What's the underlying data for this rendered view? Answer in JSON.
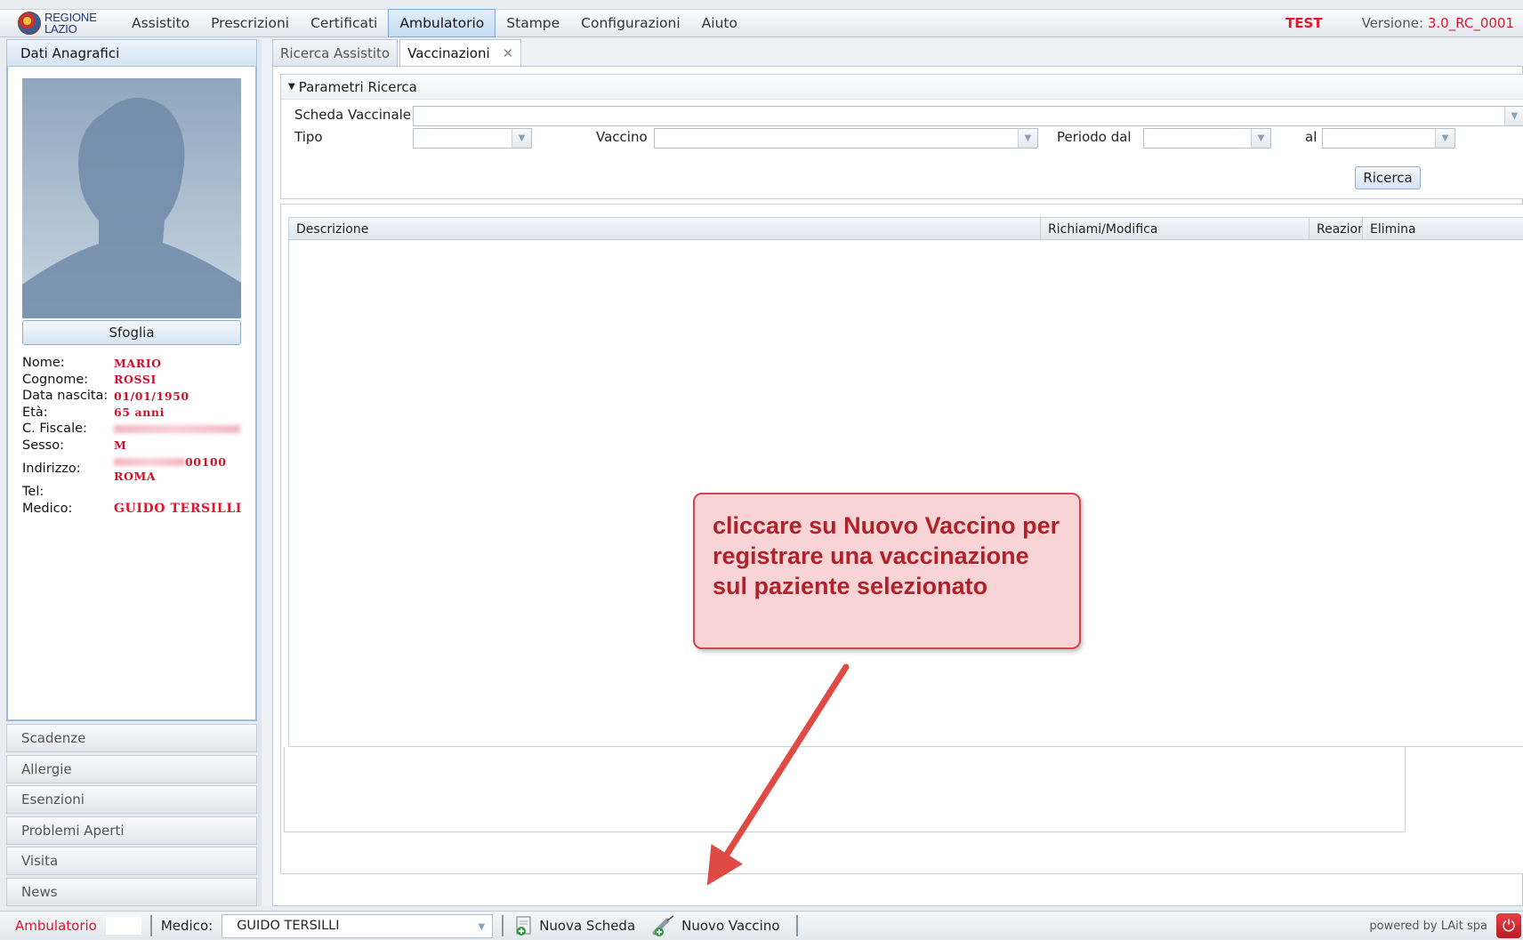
{
  "menubar": {
    "logo_line1": "REGIONE",
    "logo_line2": "LAZIO",
    "items": [
      "Assistito",
      "Prescrizioni",
      "Certificati",
      "Ambulatorio",
      "Stampe",
      "Configurazioni",
      "Aiuto"
    ],
    "active_item": "Ambulatorio",
    "env_label": "TEST",
    "version_label": "Versione:",
    "version_value": "3.0_RC_0001"
  },
  "left_panel": {
    "header": "Dati Anagrafici",
    "browse_button": "Sfoglia",
    "patient": {
      "name_label": "Nome:",
      "name": "MARIO",
      "surname_label": "Cognome:",
      "surname": "ROSSI",
      "birth_label": "Data nascita:",
      "birth": "01/01/1950",
      "age_label": "Età:",
      "age": "65 anni",
      "fiscal_label": "C. Fiscale:",
      "sex_label": "Sesso:",
      "sex": "M",
      "address_label": "Indirizzo:",
      "address_zip": "00100",
      "address_city": "ROMA",
      "tel_label": "Tel:",
      "doctor_label": "Medico:",
      "doctor": "GUIDO TERSILLI"
    },
    "accordion": [
      "Scadenze",
      "Allergie",
      "Esenzioni",
      "Problemi Aperti",
      "Visita",
      "News"
    ]
  },
  "tabs": [
    {
      "label": "Ricerca Assistito",
      "active": false
    },
    {
      "label": "Vaccinazioni",
      "active": true,
      "closable": true
    }
  ],
  "search_params": {
    "title": "Parametri Ricerca",
    "scheda_label": "Scheda Vaccinale",
    "scheda_value": "",
    "tipo_label": "Tipo",
    "tipo_value": "",
    "vaccino_label": "Vaccino",
    "vaccino_value": "",
    "periodo_label": "Periodo dal",
    "periodo_value": "",
    "al_label": "al",
    "al_value": "",
    "search_button": "Ricerca"
  },
  "grid": {
    "columns": [
      "Descrizione",
      "Richiami/Modifica",
      "Reazion",
      "Elimina"
    ],
    "rows": []
  },
  "callout": {
    "text": "cliccare su Nuovo Vaccino per registrare una vaccinazione sul paziente selezionato"
  },
  "statusbar": {
    "context": "Ambulatorio",
    "doctor_label": "Medico:",
    "doctor_value": "GUIDO TERSILLI",
    "new_card_button": "Nuova Scheda",
    "new_vaccine_button": "Nuovo Vaccino",
    "powered_by": "powered by LAit spa"
  },
  "colors": {
    "accent_red": "#e0162b",
    "active_menu_bg": "#c5dcf3",
    "callout_bg": "#f9d4d6",
    "callout_border": "#d0464d"
  },
  "icons": [
    "regione-lazio-logo",
    "avatar-silhouette",
    "close-icon",
    "chevron-down-icon",
    "new-card-icon",
    "syringe-icon",
    "power-icon"
  ]
}
